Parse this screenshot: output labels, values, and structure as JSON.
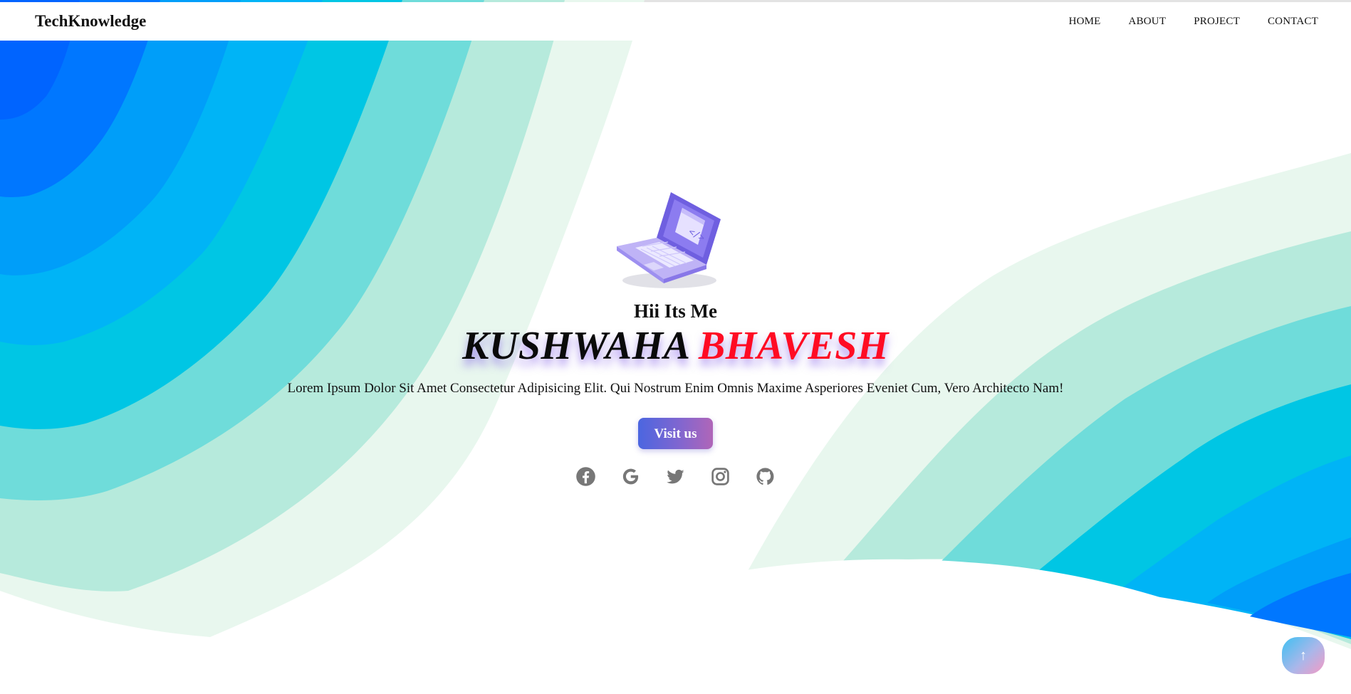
{
  "navbar": {
    "brand": "TechKnowledge",
    "links": [
      "HOME",
      "ABOUT",
      "PROJECT",
      "CONTACT"
    ]
  },
  "hero": {
    "greeting": "Hii Its Me",
    "name_first": "KUSHWAHA",
    "name_last": "BHAVESH",
    "description": "Lorem Ipsum Dolor Sit Amet Consectetur Adipisicing Elit. Qui Nostrum Enim Omnis Maxime Asperiores Eveniet Cum, Vero Architecto Nam!",
    "button_label": "Visit us",
    "illustration": "laptop-code-illustration"
  },
  "socials": [
    "facebook-icon",
    "google-icon",
    "twitter-icon",
    "instagram-icon",
    "github-icon"
  ],
  "scroll_top": {
    "icon": "arrow-up-icon",
    "glyph": "↑"
  },
  "colors": {
    "wave_palette": [
      "#e8f7ee",
      "#b6eadc",
      "#6fdcda",
      "#00c6e4",
      "#00b4f6",
      "#009ef9",
      "#0077ff",
      "#0064ff"
    ],
    "name_accent": "#ff0b23",
    "button_gradient": [
      "#4b66e0",
      "#b066b8"
    ],
    "social_icon": "#777777"
  }
}
